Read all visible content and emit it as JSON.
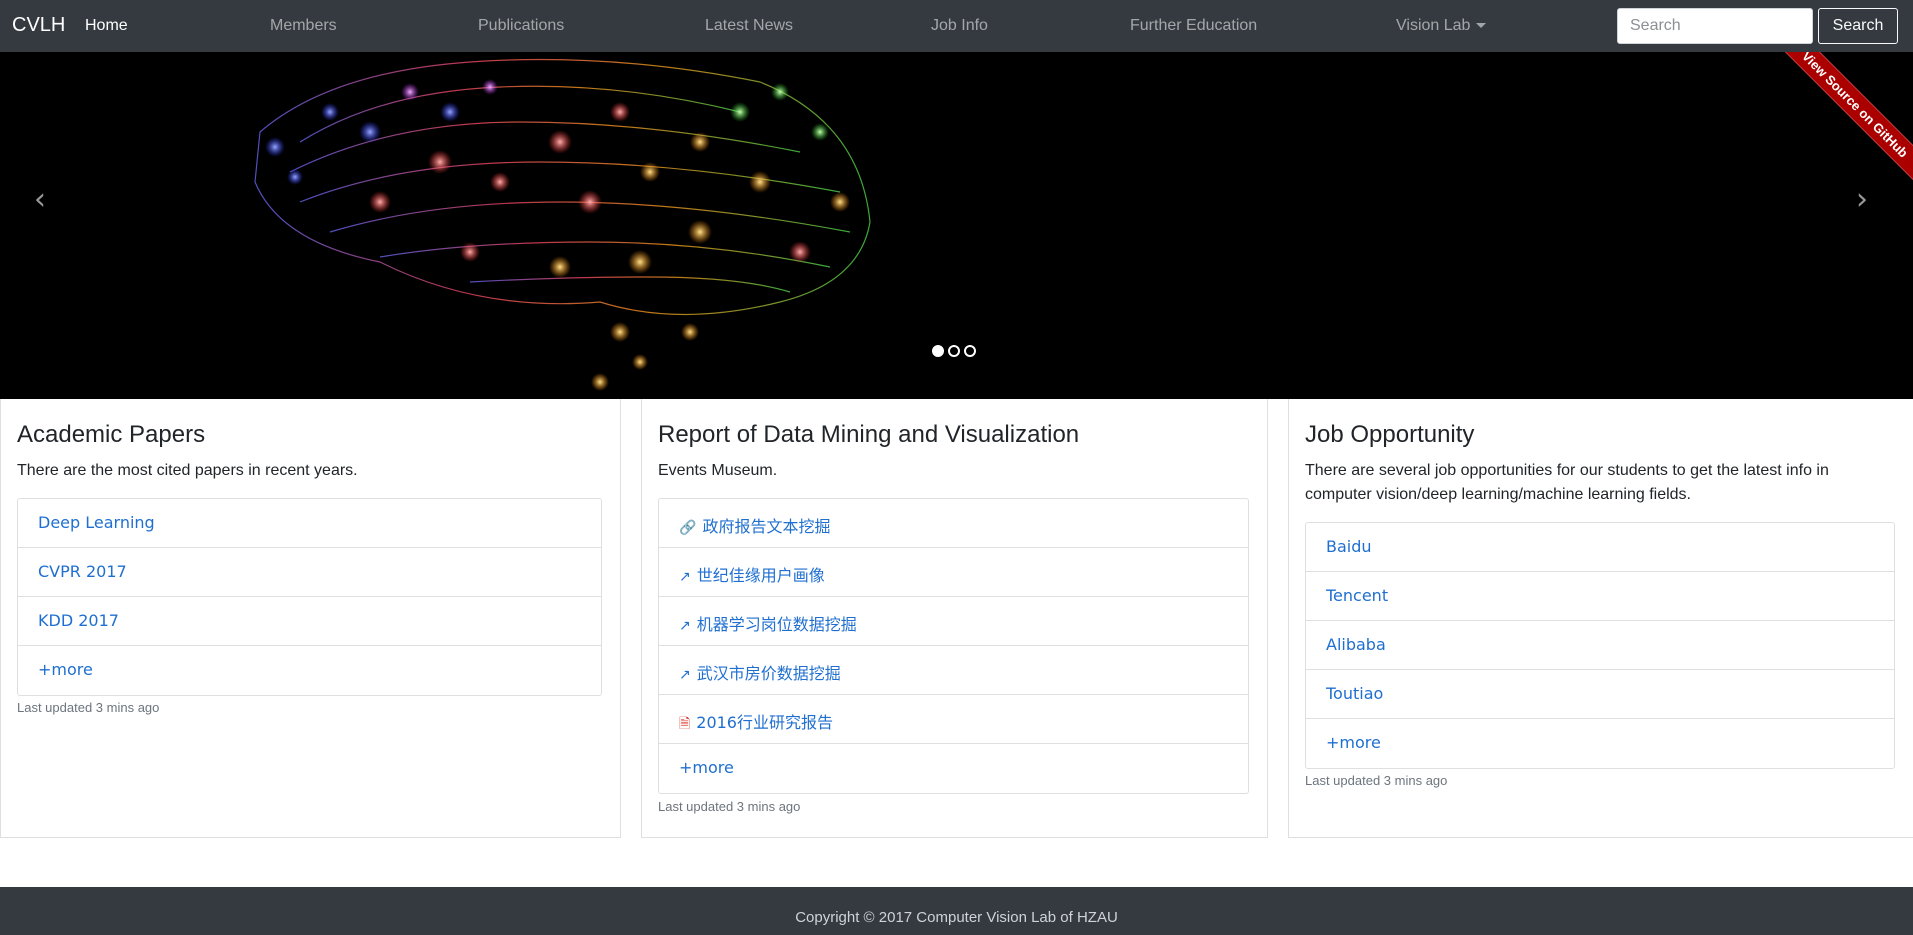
{
  "navbar": {
    "brand": "CVLH",
    "links": [
      {
        "label": "Home"
      },
      {
        "label": "Members"
      },
      {
        "label": "Publications"
      },
      {
        "label": "Latest News"
      },
      {
        "label": "Job Info"
      },
      {
        "label": "Further Education"
      },
      {
        "label": "Vision Lab"
      }
    ],
    "search_placeholder": "Search",
    "search_button": "Search"
  },
  "carousel": {
    "prev_icon": "‹",
    "next_icon": "›",
    "ribbon": "View Source on GitHub",
    "active_slide": 1,
    "slide_count": 3
  },
  "cards": [
    {
      "title": "Academic Papers",
      "desc": "There are the most cited papers in recent years.",
      "items": [
        "Deep Learning",
        "CVPR 2017",
        "KDD 2017",
        "+more"
      ],
      "updated": "Last updated 3 mins ago"
    },
    {
      "title": "Report of Data Mining and Visualization",
      "desc": "Events Museum.",
      "items": [
        {
          "icon": "link-icon",
          "label": "政府报告文本挖掘"
        },
        {
          "icon": "external-link-icon",
          "label": "世纪佳缘用户画像"
        },
        {
          "icon": "external-link-icon",
          "label": "机器学习岗位数据挖掘"
        },
        {
          "icon": "external-link-icon",
          "label": "武汉市房价数据挖掘"
        },
        {
          "icon": "pdf-icon",
          "label": "2016行业研究报告"
        },
        {
          "icon": "",
          "label": "+more"
        }
      ],
      "updated": "Last updated 3 mins ago"
    },
    {
      "title": "Job Opportunity",
      "desc": "There are several job opportunities for our students to get the latest info in computer vision/deep learning/machine learning fields.",
      "items": [
        "Baidu",
        "Tencent",
        "Alibaba",
        "Toutiao",
        "+more"
      ],
      "updated": "Last updated 3 mins ago"
    }
  ],
  "footer": {
    "copyright": "Copyright © 2017 Computer Vision Lab of HZAU"
  }
}
